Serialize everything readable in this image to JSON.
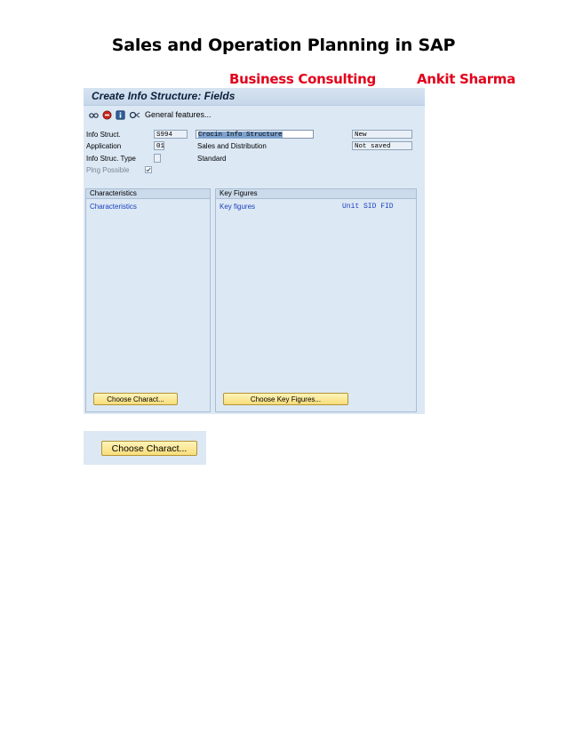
{
  "doc": {
    "title": "Sales and Operation Planning in SAP",
    "subtitle_left": "Business Consulting",
    "subtitle_right": "Ankit Sharma"
  },
  "sap": {
    "title": "Create Info Structure: Fields",
    "toolbar": {
      "general_features": "General features..."
    },
    "fields": {
      "info_struct_label": "Info Struct.",
      "info_struct_value": "S994",
      "info_struct_desc": "Crocin Info Structure",
      "info_struct_status": "New",
      "application_label": "Application",
      "application_value": "01",
      "application_desc": "Sales and Distribution",
      "application_status": "Not saved",
      "type_label": "Info Struc. Type",
      "type_desc": "Standard",
      "plng_label": "Plng Possible"
    },
    "characteristics": {
      "header": "Characteristics",
      "column": "Characteristics",
      "button": "Choose Charact..."
    },
    "key_figures": {
      "header": "Key Figures",
      "column": "Key figures",
      "column_right": "Unit SID FID",
      "button": "Choose Key Figures..."
    }
  },
  "zoom_button": "Choose Charact..."
}
